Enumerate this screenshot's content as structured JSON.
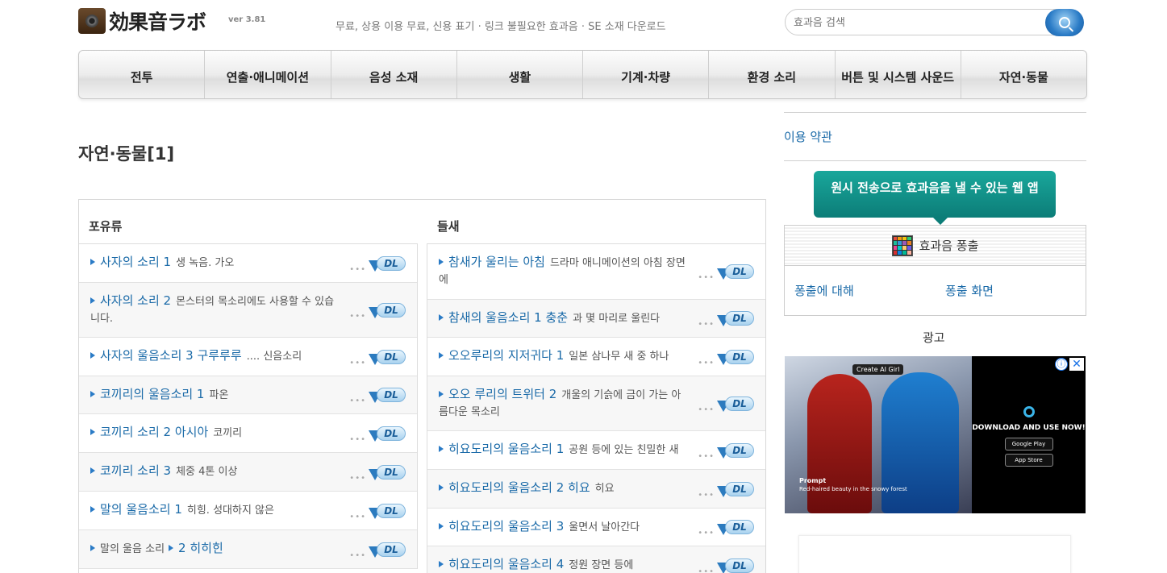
{
  "header": {
    "logo_text": "効果音ラボ",
    "version": "ver 3.81",
    "tagline": "무료, 상용 이용 무료, 신용 표기 · 링크 불필요한 효과음 · SE 소재 다운로드",
    "search_placeholder": "효과음 검색"
  },
  "nav": {
    "items": [
      "전투",
      "연출·애니메이션",
      "음성 소재",
      "생활",
      "기계·차량",
      "환경 소리",
      "버튼 및 시스템 사운드",
      "자연·동물"
    ]
  },
  "main": {
    "page_title": "자연·동물[1]",
    "columns": [
      {
        "heading": "포유류",
        "rows": [
          {
            "title": "사자의 소리 1",
            "desc": "생 녹음. 가오"
          },
          {
            "title": "사자의 소리 2",
            "desc": "몬스터의 목소리에도 사용할 수 있습니다."
          },
          {
            "title": "사자의 울음소리 3 구루루루",
            "desc": ".... 신음소리"
          },
          {
            "title": "코끼리의 울음소리 1",
            "desc": "파온"
          },
          {
            "title": "코끼리 소리 2 아시아",
            "desc": "코끼리"
          },
          {
            "title": "코끼리 소리 3",
            "desc": "체중 4톤 이상"
          },
          {
            "title": "말의 울음소리 1",
            "desc": "히힝. 성대하지 않은"
          },
          {
            "prefix": "말의 울음 소리",
            "title": "2 히히힌",
            "desc": ""
          }
        ]
      },
      {
        "heading": "들새",
        "rows": [
          {
            "title": "참새가 울리는 아침",
            "desc": "드라마 애니메이션의 아침 장면에"
          },
          {
            "title": "참새의 울음소리 1 충춘",
            "desc": "과 몇 마리로 울린다"
          },
          {
            "title": "오오루리의 지저귀다 1",
            "desc": "일본 삼나무 새 중 하나"
          },
          {
            "title": "오오 루리의 트위터 2",
            "desc": "개울의 기슭에 금이 가는 아름다운 목소리"
          },
          {
            "title": "히요도리의 울음소리 1",
            "desc": "공원 등에 있는 친밀한 새"
          },
          {
            "title": "히요도리의 울음소리 2 히요",
            "desc": "히요"
          },
          {
            "title": "히요도리의 울음소리 3",
            "desc": "울면서 날아간다"
          },
          {
            "title": "히요도리의 울음소리 4",
            "desc": "정원 장면 등에"
          }
        ]
      }
    ],
    "dl_label": "DL",
    "dots": "•••"
  },
  "sidebar": {
    "terms_link": "이용 약관",
    "promo_text": "원시 전송으로 효과음을 낼 수 있는 웹 앱",
    "box_title": "효과음 퐁출",
    "link_about": "퐁출에 대해",
    "link_screen": "퐁출 화면",
    "ad_label": "광고",
    "ad": {
      "tag": "Create AI Girl",
      "caption_title": "Prompt",
      "caption_text": "Red-haired beauty in the snowy forest",
      "cta": "DOWNLOAD AND USE NOW!",
      "store1": "Google Play",
      "store2": "App Store",
      "info": "ⓘ",
      "close": "✕"
    }
  },
  "colors": {
    "link": "#1a6aa8",
    "promo": "#0c7d78",
    "accent_blue": "#2a7bc6"
  }
}
